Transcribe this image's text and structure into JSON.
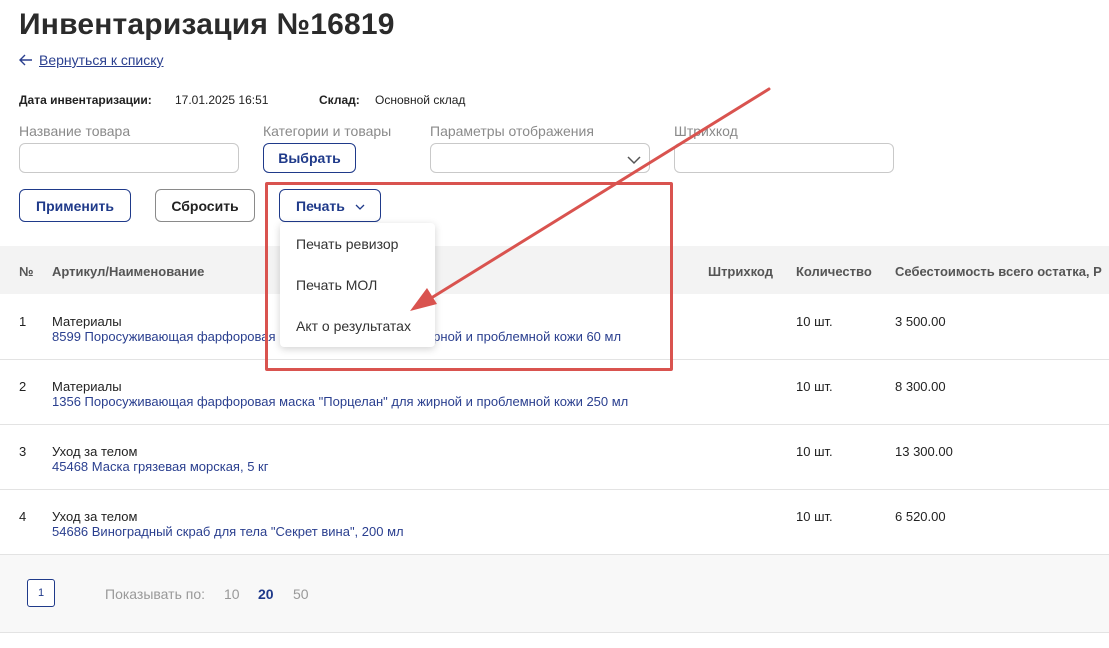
{
  "page": {
    "title": "Инвентаризация №16819",
    "back_link": "Вернуться к списку"
  },
  "meta": {
    "date_label": "Дата инвентаризации:",
    "date_value": "17.01.2025 16:51",
    "warehouse_label": "Склад:",
    "warehouse_value": "Основной склад"
  },
  "filters": {
    "product_name_label": "Название товара",
    "product_name_value": "",
    "categories_label": "Категории и товары",
    "categories_button": "Выбрать",
    "display_params_label": "Параметры отображения",
    "display_params_value": "",
    "barcode_label": "Штрихкод",
    "barcode_value": ""
  },
  "actions": {
    "apply": "Применить",
    "reset": "Сбросить",
    "print": "Печать"
  },
  "print_menu": {
    "items": [
      "Печать ревизор",
      "Печать МОЛ",
      "Акт о результатах"
    ]
  },
  "table": {
    "columns": {
      "num": "№",
      "article": "Артикул/Наименование",
      "barcode": "Штрихкод",
      "quantity": "Количество",
      "cost": "Себестоимость всего остатка, Р"
    },
    "rows": [
      {
        "num": "1",
        "category": "Материалы",
        "name": "8599 Поросуживающая фарфоровая маска \"Порцелан\" для жирной и проблемной кожи 60 мл",
        "barcode": "",
        "quantity": "10 шт.",
        "cost": "3 500.00"
      },
      {
        "num": "2",
        "category": "Материалы",
        "name": "1356 Поросуживающая фарфоровая маска \"Порцелан\" для жирной и проблемной кожи 250 мл",
        "barcode": "",
        "quantity": "10 шт.",
        "cost": "8 300.00"
      },
      {
        "num": "3",
        "category": "Уход за телом",
        "name": "45468 Маска грязевая морская, 5 кг",
        "barcode": "",
        "quantity": "10 шт.",
        "cost": "13 300.00"
      },
      {
        "num": "4",
        "category": "Уход за телом",
        "name": "54686 Виноградный скраб для тела \"Секрет вина\", 200 мл",
        "barcode": "",
        "quantity": "10 шт.",
        "cost": "6 520.00"
      }
    ]
  },
  "pagination": {
    "current_page": "1",
    "per_page_label": "Показывать по:",
    "per_page_options": [
      "10",
      "20",
      "50"
    ],
    "per_page_selected": "20"
  },
  "colors": {
    "accent": "#1f3a8a",
    "link": "#2a3f8f",
    "annotation": "#d9534f"
  }
}
